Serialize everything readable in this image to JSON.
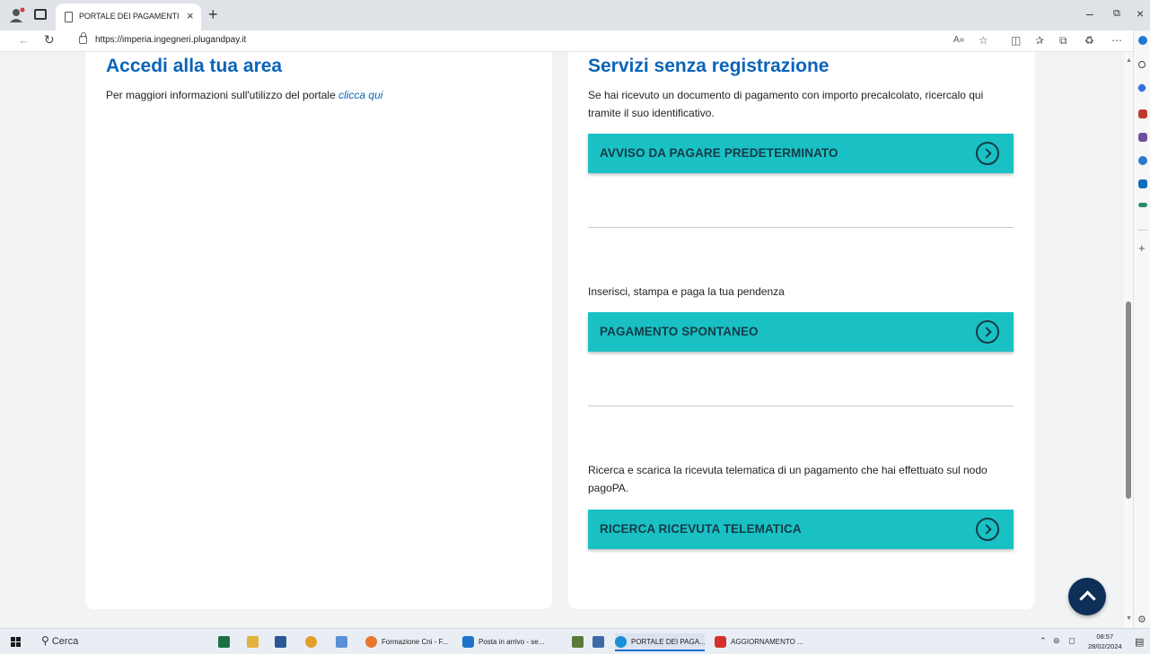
{
  "browser": {
    "tab_title": "PORTALE DEI PAGAMENTI DELL'O",
    "url_main": "https://imperia.ingegneri.plugandpay.it",
    "window_controls": {
      "minimize": "–",
      "restore": "⧉",
      "close": "×"
    },
    "new_tab": "+",
    "tab_close": "×"
  },
  "left_card": {
    "title": "Accedi alla tua area",
    "info_text": "Per maggiori informazioni sull'utilizzo del portale ",
    "info_link": "clicca qui"
  },
  "right_card": {
    "title": "Servizi senza registrazione",
    "sections": [
      {
        "description_line1": "Se hai ricevuto un documento di pagamento con importo precalcolato, ricercalo qui",
        "description_line2": "tramite il suo identificativo.",
        "button_label": "AVVISO DA PAGARE PREDETERMINATO"
      },
      {
        "description_line1": "Inserisci, stampa e paga la tua pendenza",
        "description_line2": "",
        "button_label": "PAGAMENTO SPONTANEO"
      },
      {
        "description_line1": "Ricerca e scarica la ricevuta telematica di un pagamento che hai effettuato sul nodo",
        "description_line2": "pagoPA.",
        "button_label": "RICERCA RICEVUTA TELEMATICA"
      }
    ]
  },
  "colors": {
    "heading": "#0b64b8",
    "button_bg": "#19c1c4",
    "button_text": "#143b46",
    "scroll_top_bg": "#0e2f57"
  },
  "taskbar": {
    "search_label": "Cerca",
    "items": [
      {
        "label": "Formazione Cni - F...",
        "color": "#e8762b"
      },
      {
        "label": "Posta in arrivo - se...",
        "color": "#1e73c9"
      },
      {
        "label": "PORTALE DEI PAGA...",
        "color": "#1a8fd8"
      },
      {
        "label": "AGGIORNAMENTO ...",
        "color": "#d4312b"
      }
    ],
    "time": "08:57",
    "date": "28/02/2024"
  }
}
